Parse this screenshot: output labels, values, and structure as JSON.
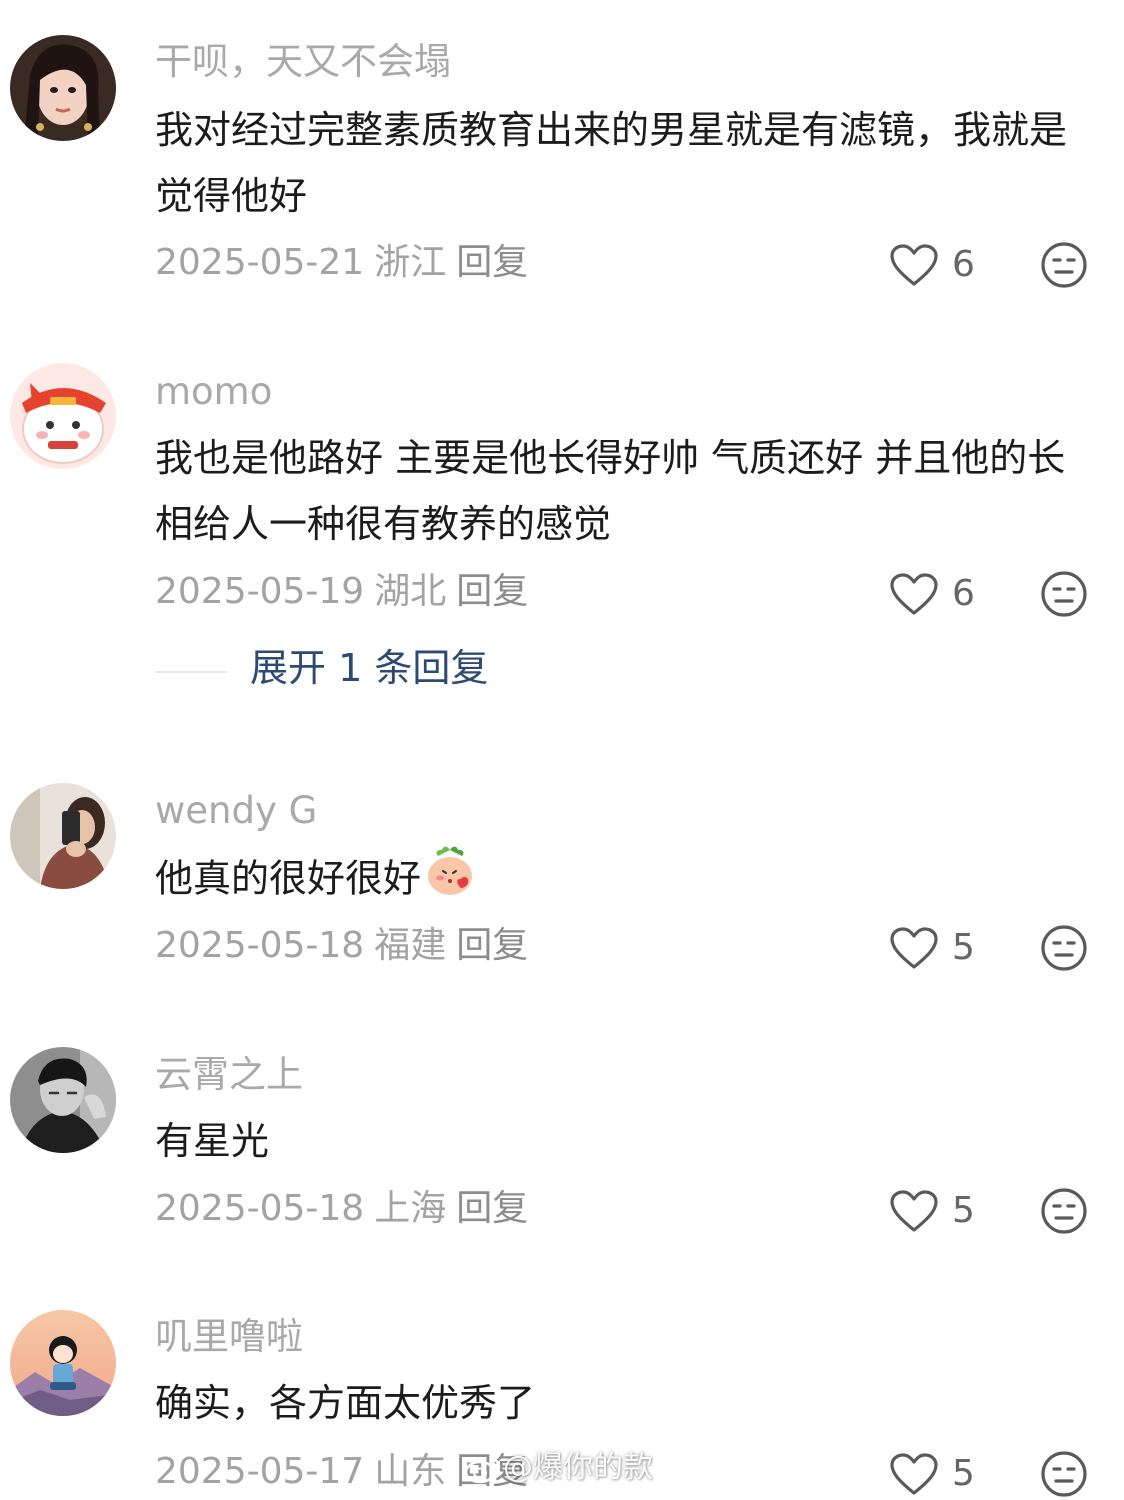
{
  "comments": [
    {
      "username": "干呗，天又不会塌",
      "text": "我对经过完整素质教育出来的男星就是有滤镜，我就是觉得他好",
      "date": "2025-05-21",
      "location": "浙江",
      "reply_label": "回复",
      "likes": "6"
    },
    {
      "username": "momo",
      "text": "我也是他路好 主要是他长得好帅 气质还好 并且他的长相给人一种很有教养的感觉",
      "date": "2025-05-19",
      "location": "湖北",
      "reply_label": "回复",
      "likes": "6",
      "expand_replies": "展开 1 条回复"
    },
    {
      "username": "wendy G",
      "text": "他真的很好很好",
      "emoji": "peach-face-emoji",
      "date": "2025-05-18",
      "location": "福建",
      "reply_label": "回复",
      "likes": "5"
    },
    {
      "username": "云霄之上",
      "text": "有星光",
      "date": "2025-05-18",
      "location": "上海",
      "reply_label": "回复",
      "likes": "5"
    },
    {
      "username": "叽里噜啦",
      "text": "确实，各方面太优秀了",
      "date": "2025-05-17",
      "location": "山东",
      "reply_label": "回复",
      "likes": "5"
    }
  ],
  "watermark": "@爆你的款",
  "icons": {
    "like": "heart-outline-icon",
    "dislike": "neutral-face-icon"
  },
  "colors": {
    "username": "#a9a9a9",
    "text": "#1c1c1c",
    "meta": "#a3a3a3",
    "expand": "#2c4a72"
  }
}
